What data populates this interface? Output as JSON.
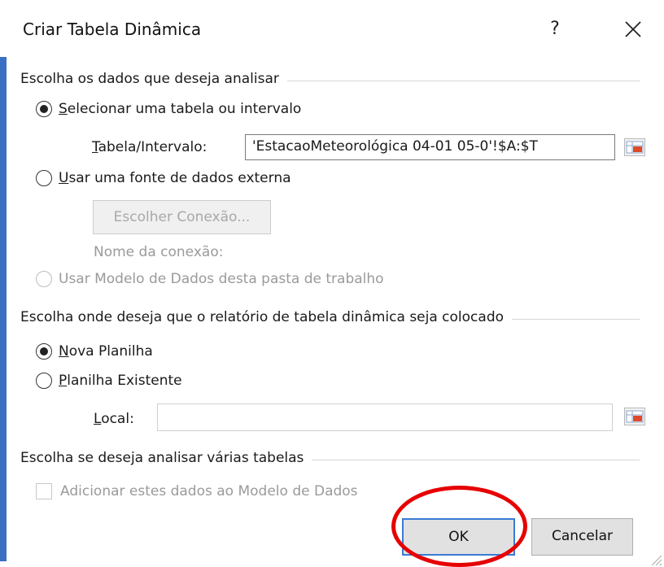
{
  "dialog": {
    "title": "Criar Tabela Dinâmica",
    "help_label": "?",
    "close_label": "✕"
  },
  "source_group": {
    "title": "Escolha os dados que deseja analisar",
    "option_select_table": {
      "accel": "S",
      "rest": "elecionar uma tabela ou intervalo",
      "selected": true
    },
    "range_label_accel": "T",
    "range_label_rest": "abela/Intervalo:",
    "range_value": "'EstacaoMeteorológica 04-01 05-0'!$A:$T",
    "option_external": {
      "accel": "U",
      "rest": "sar uma fonte de dados externa",
      "selected": false
    },
    "choose_connection_button": "Escolher Conexão...",
    "connection_name_label": "Nome da conexão:",
    "option_data_model": {
      "label": "Usar Modelo de Dados desta pasta de trabalho",
      "selected": false,
      "disabled": true
    }
  },
  "destination_group": {
    "title": "Escolha onde deseja que o relatório de tabela dinâmica seja colocado",
    "option_new_sheet": {
      "accel": "N",
      "rest": "ova Planilha",
      "selected": true
    },
    "option_existing_sheet": {
      "accel": "P",
      "rest": "lanilha Existente",
      "selected": false
    },
    "location_label_accel": "L",
    "location_label_rest": "ocal:",
    "location_value": ""
  },
  "multiple_tables_group": {
    "title": "Escolha se deseja analisar várias tabelas",
    "add_to_data_model_label": "Adicionar estes dados ao Modelo de Dados",
    "add_to_data_model_checked": false
  },
  "buttons": {
    "ok": "OK",
    "cancel": "Cancelar"
  },
  "colors": {
    "accent": "#3b6fc4",
    "annotation": "#e60000"
  }
}
